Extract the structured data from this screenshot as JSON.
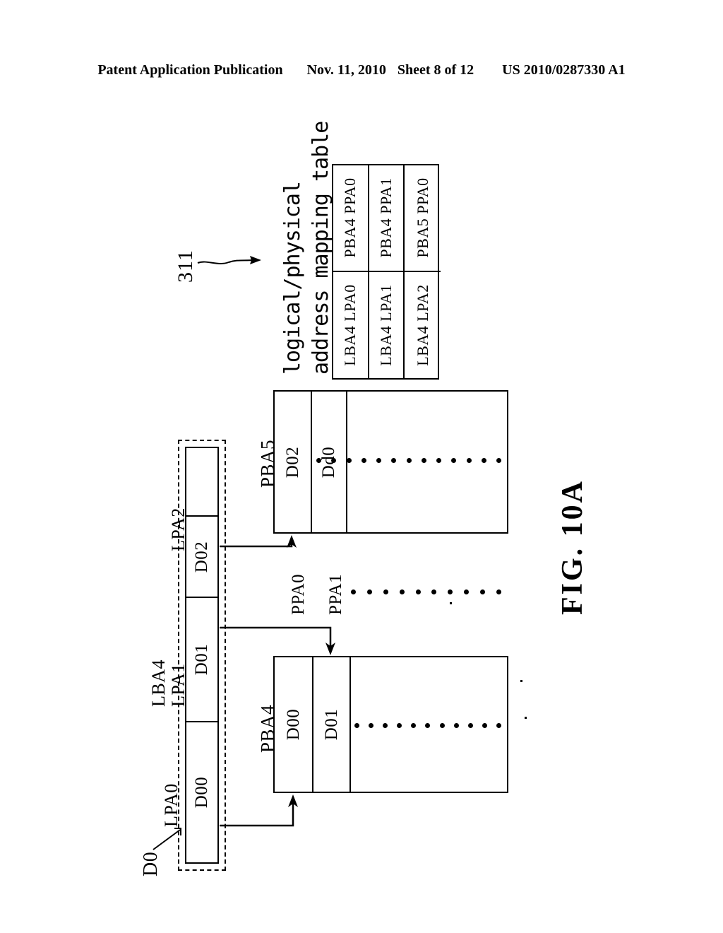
{
  "header": {
    "left": "Patent Application Publication",
    "date": "Nov. 11, 2010",
    "sheet": "Sheet 8 of 12",
    "number": "US 2010/0287330 A1"
  },
  "figure": {
    "label": "FIG. 10A",
    "reference_numeral": "311"
  },
  "mapping_table": {
    "title_line1": "logical/physical",
    "title_line2": "address mapping table",
    "rows": [
      {
        "logical": "LBA4 LPA0",
        "physical": "PBA4 PPA0"
      },
      {
        "logical": "LBA4 LPA1",
        "physical": "PBA4 PPA1"
      },
      {
        "logical": "LBA4 LPA2",
        "physical": "PBA5 PPA0"
      }
    ]
  },
  "logical_group": {
    "group_label": "D0",
    "lba_label": "LBA4",
    "cells": [
      {
        "lpa": "LPA2",
        "data": "D02"
      },
      {
        "lpa": "LPA1",
        "data": "D01"
      },
      {
        "lpa": "LPA0",
        "data": "D00"
      }
    ],
    "empty_cell": ""
  },
  "physical_blocks": [
    {
      "name": "PBA5",
      "cells": [
        "D02",
        "Dd0"
      ],
      "dots": 13
    },
    {
      "name": "PBA4",
      "cells": [
        "D00",
        "D01"
      ],
      "dots": 11
    }
  ],
  "page_addresses": {
    "ppa0": "PPA0",
    "ppa1": "PPA1",
    "mid_dots": 10
  }
}
